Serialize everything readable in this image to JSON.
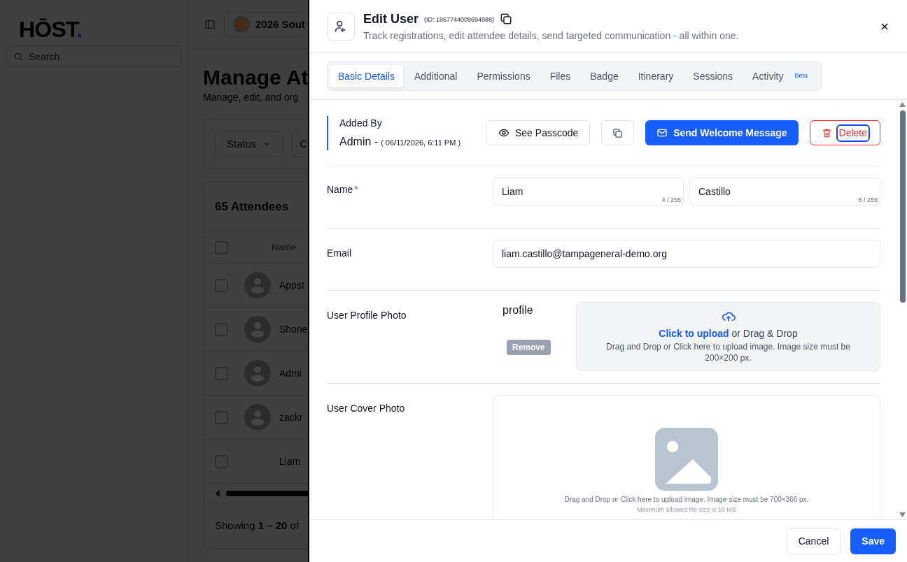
{
  "background": {
    "logo": {
      "text": "HŌST",
      "dot": "."
    },
    "search": {
      "placeholder": "Search"
    },
    "event_select": "2026 Sout",
    "title": "Manage At",
    "subtitle": "Manage, edit, and org",
    "filters": [
      "Status",
      "C"
    ],
    "table": {
      "title": "65 Attendees",
      "column": "Name",
      "header_checked": false,
      "rows": [
        {
          "name": "Appst",
          "avatar": true,
          "checked": false
        },
        {
          "name": "Shone",
          "avatar": true,
          "checked": false
        },
        {
          "name": "Admi",
          "avatar": true,
          "checked": false
        },
        {
          "name": "zackr",
          "avatar": true,
          "checked": false
        },
        {
          "name": "Liam",
          "avatar": false,
          "checked": false
        }
      ],
      "footer": "Showing **1 – 20** of"
    }
  },
  "modal": {
    "title": "Edit User",
    "id": "(ID: 1867744009694988)",
    "subtitle": "Track registrations, edit attendee details, send targeted communication - all within one.",
    "tabs": [
      {
        "label": "Basic Details",
        "selected": true
      },
      {
        "label": "Additional",
        "selected": false
      },
      {
        "label": "Permissions",
        "selected": false
      },
      {
        "label": "Files",
        "selected": false
      },
      {
        "label": "Badge",
        "selected": false
      },
      {
        "label": "Itinerary",
        "selected": false
      },
      {
        "label": "Sessions",
        "selected": false
      },
      {
        "label": "Activity",
        "selected": false,
        "badge": "Beta"
      }
    ],
    "added_by": {
      "label": "Added By",
      "name": "Admin -",
      "date": "( 06/11/2026, 6:11 PM )"
    },
    "actions": {
      "see_passcode": "See Passcode",
      "send_welcome": "Send Welcome Message",
      "delete": "Delete"
    },
    "name": {
      "label": "Name",
      "required_mark": "*",
      "first": {
        "value": "Liam",
        "counter": "4 / 255"
      },
      "last": {
        "value": "Castillo",
        "counter": "8 / 255"
      }
    },
    "email": {
      "label": "Email",
      "value": "liam.castillo@tampageneral-demo.org"
    },
    "profile_photo": {
      "label": "User Profile Photo",
      "alt_text": "profile",
      "remove": "Remove",
      "upload_link": "Click to upload",
      "upload_rest": "or Drag & Drop",
      "hint": "Drag and Drop or Click here to upload image. Image size must be 200×200 px."
    },
    "cover_photo": {
      "label": "User Cover Photo",
      "hint": "Drag and Drop or Click here to upload image. Image size must be 700×366 px.",
      "max_size": "Maximum allowed file size is 50 MB"
    },
    "footer": {
      "cancel": "Cancel",
      "save": "Save"
    }
  }
}
